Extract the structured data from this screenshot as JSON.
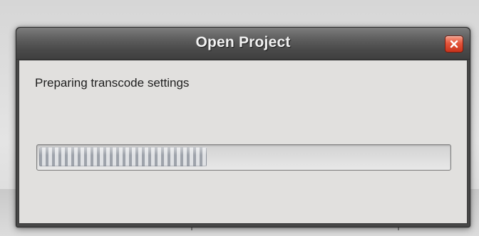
{
  "dialog": {
    "title": "Open Project",
    "close_icon": "close-icon",
    "message": "Preparing transcode settings",
    "progress": {
      "fraction": 0.41
    }
  },
  "colors": {
    "titlebar": "#4f4f4f",
    "close_button": "#d9432a",
    "client_background": "#e1e0de",
    "progress_segment": "#9ea3ab"
  }
}
